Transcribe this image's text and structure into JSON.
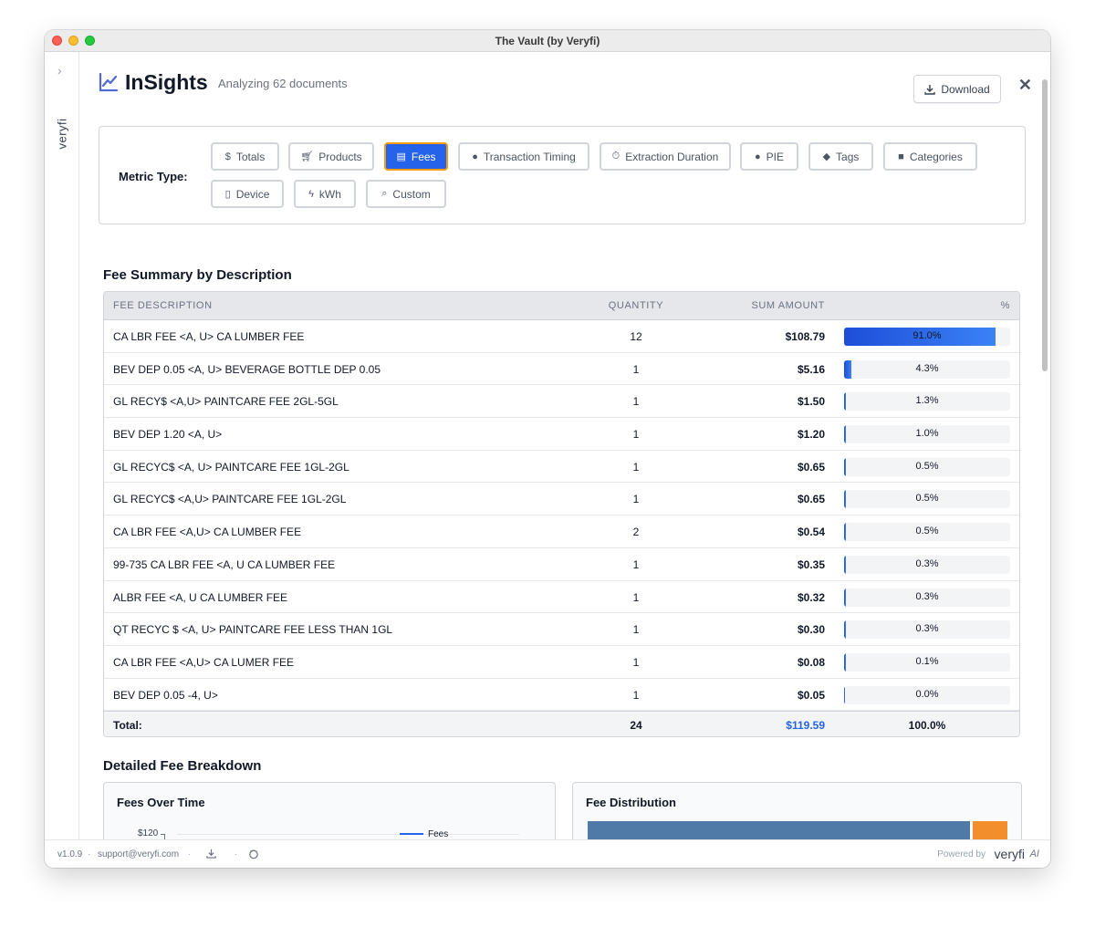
{
  "window": {
    "title": "The Vault (by Veryfi)"
  },
  "sidebar": {
    "brand": "veryfi"
  },
  "header": {
    "app_name": "InSights",
    "subtitle": "Analyzing 62 documents",
    "download_label": "Download"
  },
  "metric": {
    "label": "Metric Type:",
    "buttons": [
      {
        "label": "Totals",
        "icon": "dollar-icon",
        "active": false
      },
      {
        "label": "Products",
        "icon": "cart-icon",
        "active": false
      },
      {
        "label": "Fees",
        "icon": "receipt-icon",
        "active": true
      },
      {
        "label": "Transaction Timing",
        "icon": "clock-icon",
        "active": false
      },
      {
        "label": "Extraction Duration",
        "icon": "stopwatch-icon",
        "active": false
      },
      {
        "label": "PIE",
        "icon": "lightbulb-icon",
        "active": false
      },
      {
        "label": "Tags",
        "icon": "tag-icon",
        "active": false
      },
      {
        "label": "Categories",
        "icon": "folder-icon",
        "active": false
      },
      {
        "label": "Device",
        "icon": "device-icon",
        "active": false
      },
      {
        "label": "kWh",
        "icon": "bolt-icon",
        "active": false
      },
      {
        "label": "Custom",
        "icon": "search-icon",
        "active": false
      }
    ]
  },
  "summary": {
    "title": "Fee Summary by Description",
    "columns": {
      "desc": "FEE DESCRIPTION",
      "qty": "QUANTITY",
      "sum": "SUM AMOUNT",
      "pct": "%"
    },
    "rows": [
      {
        "desc": "CA LBR FEE <A, U> CA LUMBER FEE",
        "qty": "12",
        "sum": "$108.79",
        "pct": "91.0%",
        "fill": 0.91
      },
      {
        "desc": "BEV DEP 0.05 <A, U> BEVERAGE BOTTLE DEP 0.05",
        "qty": "1",
        "sum": "$5.16",
        "pct": "4.3%",
        "fill": 0.043
      },
      {
        "desc": "GL RECY$ <A,U> PAINTCARE FEE 2GL-5GL",
        "qty": "1",
        "sum": "$1.50",
        "pct": "1.3%",
        "fill": 0.013
      },
      {
        "desc": "BEV DEP 1.20 <A, U>",
        "qty": "1",
        "sum": "$1.20",
        "pct": "1.0%",
        "fill": 0.01
      },
      {
        "desc": "GL RECYC$ <A, U> PAINTCARE FEE 1GL-2GL",
        "qty": "1",
        "sum": "$0.65",
        "pct": "0.5%",
        "fill": 0.005
      },
      {
        "desc": "GL RECYC$ <A,U> PAINTCARE FEE 1GL-2GL",
        "qty": "1",
        "sum": "$0.65",
        "pct": "0.5%",
        "fill": 0.005
      },
      {
        "desc": "CA LBR FEE <A,U> CA LUMBER FEE",
        "qty": "2",
        "sum": "$0.54",
        "pct": "0.5%",
        "fill": 0.005
      },
      {
        "desc": "99-735 CA LBR FEE <A, U CA LUMBER FEE",
        "qty": "1",
        "sum": "$0.35",
        "pct": "0.3%",
        "fill": 0.003
      },
      {
        "desc": "ALBR FEE <A, U CA LUMBER FEE",
        "qty": "1",
        "sum": "$0.32",
        "pct": "0.3%",
        "fill": 0.003
      },
      {
        "desc": "QT RECYC $ <A, U> PAINTCARE FEE LESS THAN 1GL",
        "qty": "1",
        "sum": "$0.30",
        "pct": "0.3%",
        "fill": 0.003
      },
      {
        "desc": "CA LBR FEE <A,U> CA LUMER FEE",
        "qty": "1",
        "sum": "$0.08",
        "pct": "0.1%",
        "fill": 0.001
      },
      {
        "desc": "BEV DEP 0.05 -4, U>",
        "qty": "1",
        "sum": "$0.05",
        "pct": "0.0%",
        "fill": 0.0
      }
    ],
    "total": {
      "label": "Total:",
      "qty": "24",
      "sum": "$119.59",
      "pct": "100.0%"
    }
  },
  "breakdown": {
    "title": "Detailed Fee Breakdown",
    "over_time": {
      "title": "Fees Over Time",
      "y_tick": "$120",
      "legend": "Fees"
    },
    "distribution": {
      "title": "Fee Distribution",
      "fill": 0.91
    }
  },
  "footer": {
    "version": "v1.0.9",
    "email": "support@veryfi.com",
    "powered_by": "Powered by",
    "brand": "veryfi",
    "brand_suffix": "AI"
  },
  "colors": {
    "accent": "#2563eb",
    "active_border": "#f59e0b",
    "bar_blue": "#4f79a7",
    "bar_orange": "#f28e2b"
  }
}
